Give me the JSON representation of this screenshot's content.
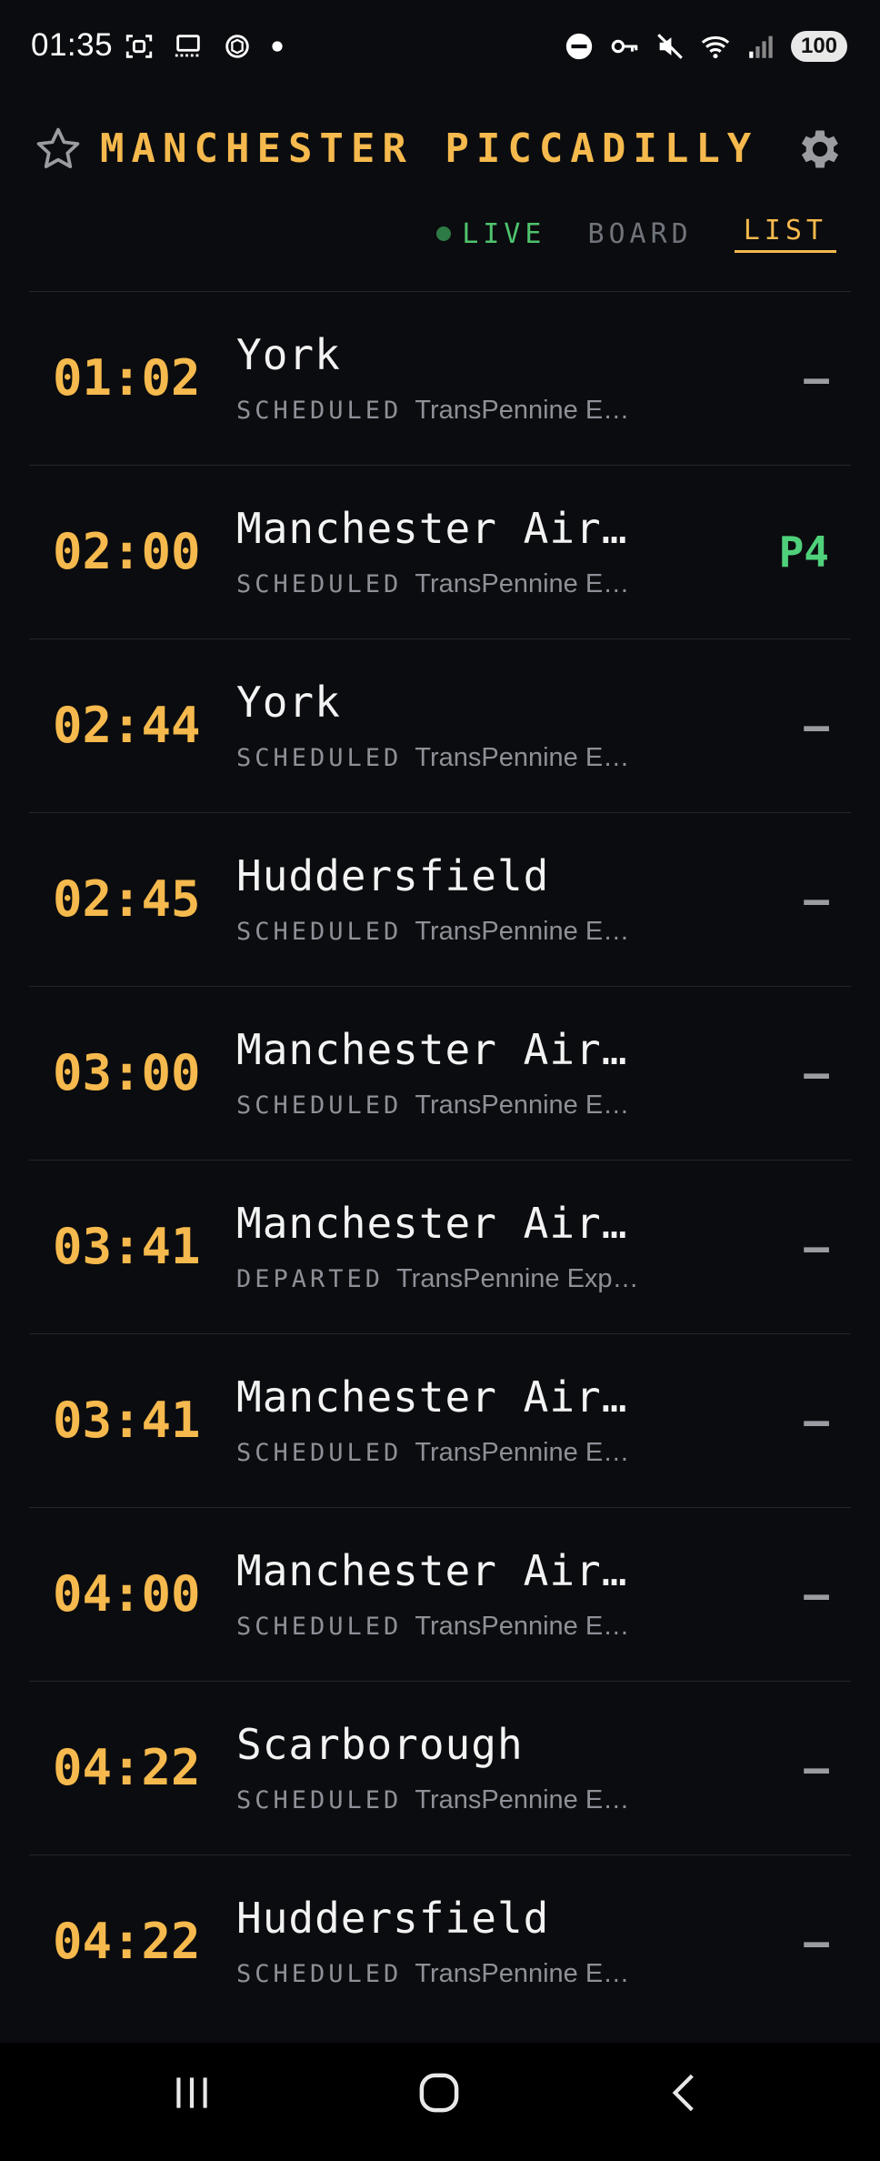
{
  "status_bar": {
    "time": "01:35",
    "battery": "100",
    "left_icons": [
      "screenshot-icon",
      "cast-icon",
      "chatgpt-icon",
      "notification-dot-icon"
    ],
    "right_icons": [
      "do-not-disturb-icon",
      "vpn-key-icon",
      "mute-icon",
      "wifi-icon",
      "signal-icon"
    ]
  },
  "header": {
    "title": "MANCHESTER PICCADILLY",
    "favorite_icon": "star-outline-icon",
    "settings_icon": "gear-icon"
  },
  "tabs": [
    {
      "label": "LIVE",
      "state": "live"
    },
    {
      "label": "BOARD",
      "state": "inactive"
    },
    {
      "label": "LIST",
      "state": "selected"
    }
  ],
  "departures": [
    {
      "time": "01:02",
      "destination": "York",
      "status": "SCHEDULED",
      "operator": "TransPennine E…",
      "platform": "—"
    },
    {
      "time": "02:00",
      "destination": "Manchester Air…",
      "status": "SCHEDULED",
      "operator": "TransPennine E…",
      "platform": "P4"
    },
    {
      "time": "02:44",
      "destination": "York",
      "status": "SCHEDULED",
      "operator": "TransPennine E…",
      "platform": "—"
    },
    {
      "time": "02:45",
      "destination": "Huddersfield",
      "status": "SCHEDULED",
      "operator": "TransPennine E…",
      "platform": "—"
    },
    {
      "time": "03:00",
      "destination": "Manchester Air…",
      "status": "SCHEDULED",
      "operator": "TransPennine E…",
      "platform": "—"
    },
    {
      "time": "03:41",
      "destination": "Manchester Air…",
      "status": "DEPARTED",
      "operator": "TransPennine Exp…",
      "platform": "—"
    },
    {
      "time": "03:41",
      "destination": "Manchester Air…",
      "status": "SCHEDULED",
      "operator": "TransPennine E…",
      "platform": "—"
    },
    {
      "time": "04:00",
      "destination": "Manchester Air…",
      "status": "SCHEDULED",
      "operator": "TransPennine E…",
      "platform": "—"
    },
    {
      "time": "04:22",
      "destination": "Scarborough",
      "status": "SCHEDULED",
      "operator": "TransPennine E…",
      "platform": "—"
    },
    {
      "time": "04:22",
      "destination": "Huddersfield",
      "status": "SCHEDULED",
      "operator": "TransPennine E…",
      "platform": "—"
    }
  ],
  "colors": {
    "background": "#0b0c0f",
    "accent": "#f5b94d",
    "live": "#4fc36e",
    "platform_assigned": "#4fd07a",
    "muted": "#8d9097"
  },
  "nav_bar": {
    "icons": [
      "recent-apps-icon",
      "home-icon",
      "back-icon"
    ]
  }
}
